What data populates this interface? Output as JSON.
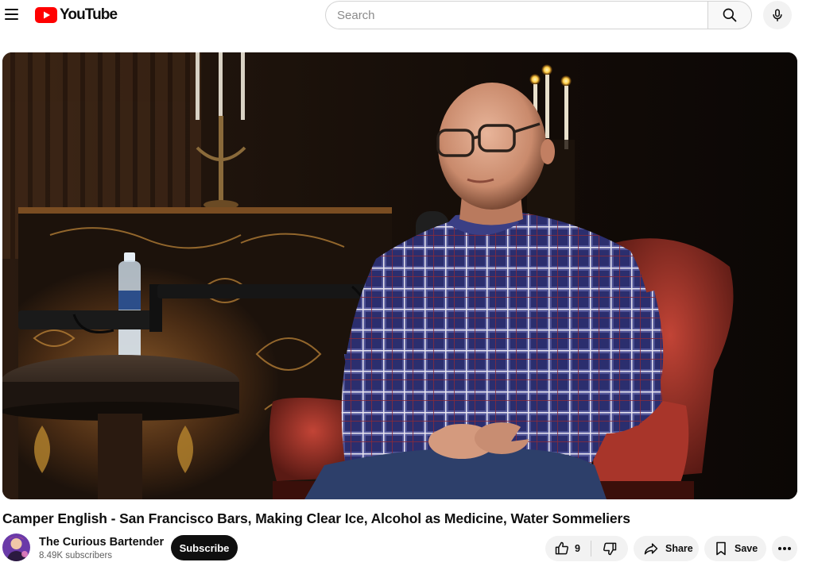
{
  "header": {
    "logo_text": "YouTube",
    "search_placeholder": "Search",
    "search_value": ""
  },
  "video": {
    "title": "Camper English - San Francisco Bars, Making Clear Ice, Alcohol as Medicine, Water Sommeliers"
  },
  "channel": {
    "name": "The Curious Bartender",
    "subscribers": "8.49K subscribers",
    "subscribe_label": "Subscribe"
  },
  "actions": {
    "like_count": "9",
    "share_label": "Share",
    "save_label": "Save"
  },
  "colors": {
    "brand_red": "#ff0000",
    "text_primary": "#0f0f0f",
    "text_secondary": "#606060",
    "chip_bg": "#f2f2f2",
    "subscribe_bg": "#0f0f0f"
  },
  "icons": [
    "menu-icon",
    "youtube-logo-icon",
    "search-icon",
    "microphone-icon",
    "thumbs-up-icon",
    "thumbs-down-icon",
    "share-arrow-icon",
    "bookmark-icon",
    "more-horizontal-icon"
  ]
}
